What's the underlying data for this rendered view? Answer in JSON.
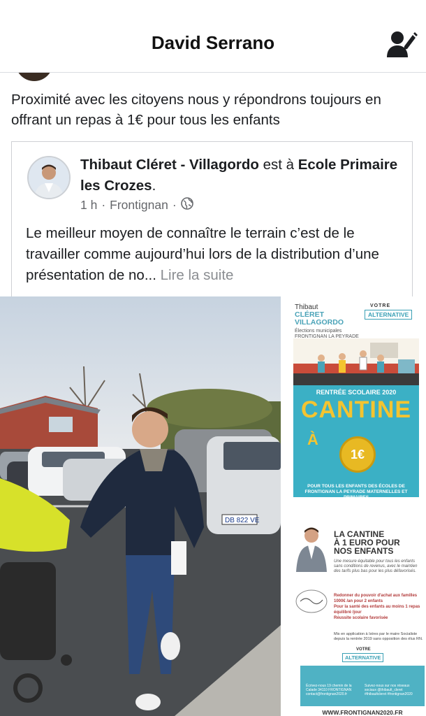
{
  "header": {
    "title": "David Serrano",
    "action_icon": "user-edit-icon"
  },
  "post": {
    "text": "Proximité avec les citoyens nous y répondrons toujours en offrant un repas à 1€ pour tous les enfants"
  },
  "shared_post": {
    "author": "Thibaut Cléret - Villagordo",
    "connector": " est à ",
    "place": "Ecole Primaire les Crozes",
    "place_suffix": ".",
    "time": "1 h",
    "separator": "·",
    "location": "Frontignan",
    "privacy_icon": "globe-icon",
    "body": "Le meilleur moyen de connaître le terrain c’est de le travailler comme aujourd’hui lors de la distribution d’une présentation de no...",
    "read_more": "Lire la suite"
  },
  "flyer_top": {
    "name_small": "Thibaut",
    "name_line1": "CLÉRET",
    "name_line2": "VILLAGORDO",
    "sub_line1": "Élections municipales",
    "sub_line2": "FRONTIGNAN LA PEYRADE",
    "sub_line3": "2020",
    "votre": "VOTRE",
    "alter": "ALTERNATIVE",
    "rentree": "RENTRÉE SCOLAIRE 2020",
    "cantine": "CANTINE",
    "a": "À",
    "price": "1€",
    "footer": "POUR TOUS LES ENFANTS DES ÉCOLES DE FRONTIGNAN LA PEYRADE MATERNELLES ET PRIMAIRES"
  },
  "flyer_bottom": {
    "title_line1": "LA CANTINE",
    "title_line2": "À 1 EURO POUR",
    "title_line3": "NOS ENFANTS",
    "desc": "Une mesure équitable pour tous les enfants sans conditions de revenus, avec le maintien des tarifs plus bas pour les plus défavorisés.",
    "item1": "Redonner du pouvoir d'achat aux familles 1000€ /an pour 2 enfants",
    "item2": "Pour la santé des enfants au moins 1 repas équilibré /jour",
    "item3": "Réussite scolaire favorisée",
    "note": "Mis en application à Istres par le maire Socialiste depuis la rentrée 2019 sans opposition des élus RN.",
    "votre": "VOTRE",
    "alter": "ALTERNATIVE",
    "contact": "Écrivez-nous 19 chemin de la Calade 34110 FRONTIGNAN contact@frontignan2020.fr",
    "social": "Suivez-nous sur nos réseaux sociaux @thibault_cleret #thibaultcleret #frontignan2020",
    "url": "WWW.FRONTIGNAN2020.FR"
  },
  "photo_left_plate": "DB 822 VE"
}
